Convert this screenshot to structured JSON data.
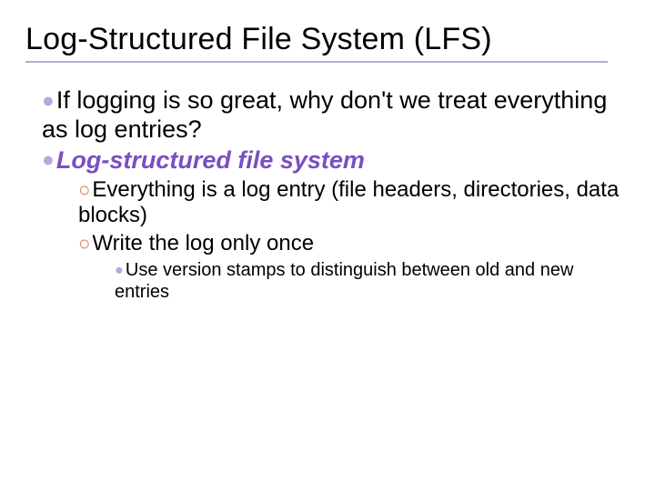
{
  "title": "Log-Structured File System (LFS)",
  "bullets": {
    "lvl1": [
      "If logging is so great, why don't we treat everything as log entries?",
      "Log-structured file system"
    ],
    "lvl2": [
      "Everything is a log entry (file headers, directories, data blocks)",
      "Write the log only once"
    ],
    "lvl3": [
      "Use version stamps to distinguish between old and new entries"
    ]
  }
}
